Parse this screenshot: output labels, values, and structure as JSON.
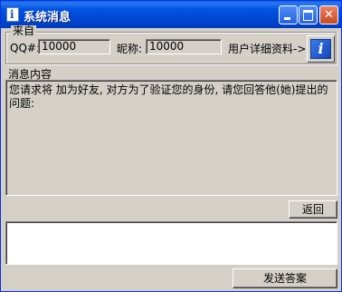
{
  "window": {
    "title": "系统消息",
    "icon": "qq-info-icon"
  },
  "source": {
    "group_label": "来自",
    "qq_label": "QQ#:",
    "qq_value": "10000",
    "nickname_label": "昵称:",
    "nickname_value": "10000",
    "user_info_label": "用户详细资料->",
    "user_info_icon": "info-icon"
  },
  "message": {
    "label": "消息内容",
    "text": "您请求将    加为好友, 对方为了验证您的身份, 请您回答他(她)提出的问题:"
  },
  "buttons": {
    "back": "返回",
    "send": "发送答案"
  },
  "answer": {
    "value": ""
  }
}
